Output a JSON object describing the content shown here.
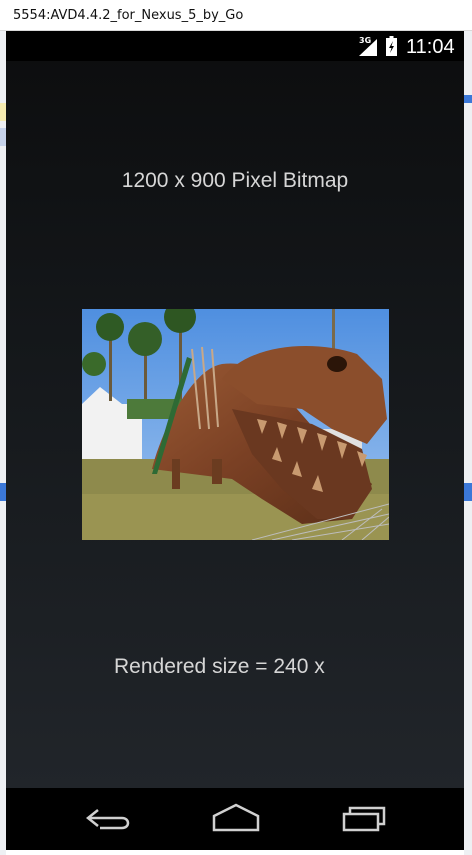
{
  "window": {
    "title": "5554:AVD4.4.2_for_Nexus_5_by_Go"
  },
  "status_bar": {
    "network_type": "3G",
    "time": "11:04",
    "icons": [
      "signal-3g-icon",
      "battery-charging-icon"
    ]
  },
  "content": {
    "heading": "1200 x 900 Pixel Bitmap",
    "image_description_icon": "dinosaur-sculpture-photo",
    "caption": "Rendered size = 240 x"
  },
  "nav_bar": {
    "buttons": [
      "back-icon",
      "home-icon",
      "recent-apps-icon"
    ]
  },
  "colors": {
    "status_bar": "#000000",
    "screen_top": "#0c0d0e",
    "screen_bottom": "#21252a",
    "text": "#d6d6d6",
    "nav_bar": "#000000"
  }
}
